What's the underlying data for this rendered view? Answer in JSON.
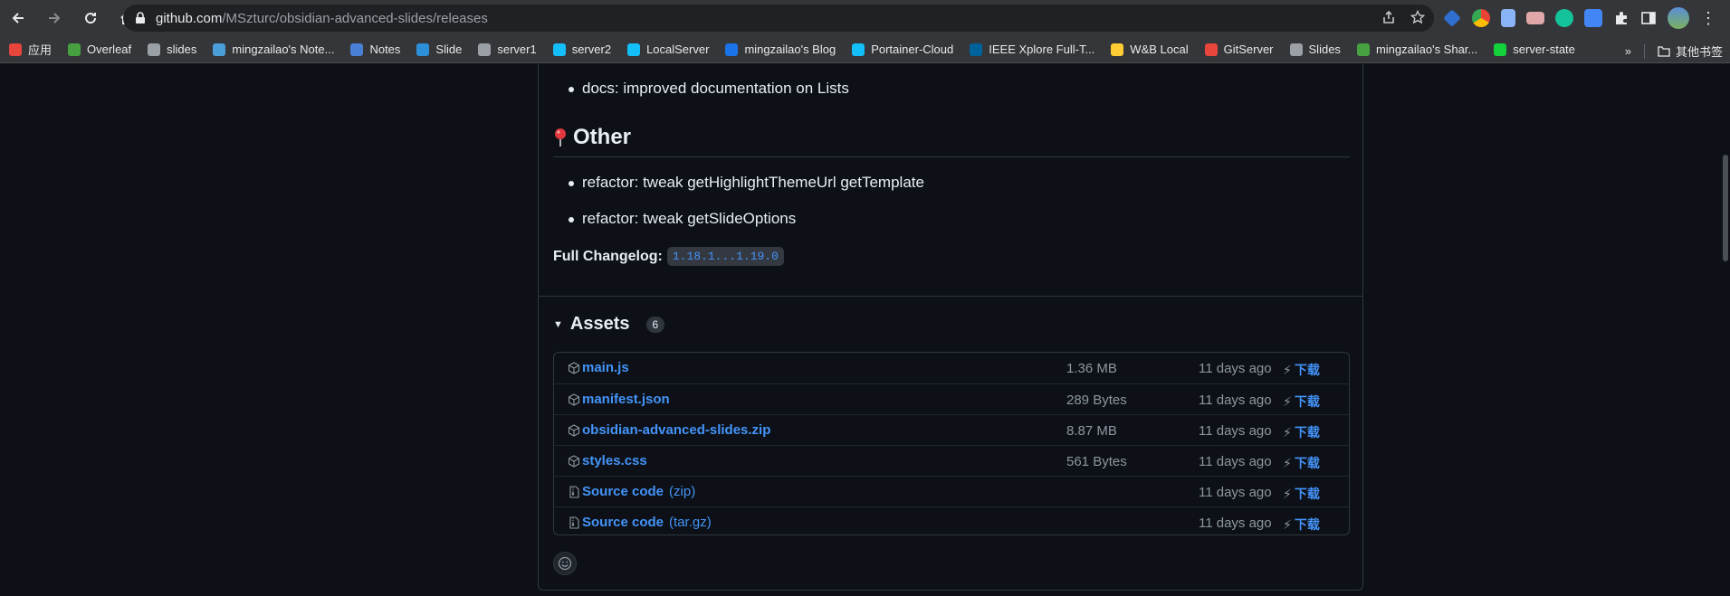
{
  "browser": {
    "url_host": "github.com",
    "url_path": "/MSzturc/obsidian-advanced-slides/releases"
  },
  "bookmarks": [
    {
      "label": "应用",
      "color": "#e8453c"
    },
    {
      "label": "Overleaf",
      "color": "#47a141"
    },
    {
      "label": "slides",
      "color": "#9aa0a6"
    },
    {
      "label": "mingzailao's Note...",
      "color": "#4a9fd8"
    },
    {
      "label": "Notes",
      "color": "#4a7fd8"
    },
    {
      "label": "Slide",
      "color": "#2d8fd8"
    },
    {
      "label": "server1",
      "color": "#9aa0a6"
    },
    {
      "label": "server2",
      "color": "#13bef9"
    },
    {
      "label": "LocalServer",
      "color": "#13bef9"
    },
    {
      "label": "mingzailao's Blog",
      "color": "#1a73e8"
    },
    {
      "label": "Portainer-Cloud",
      "color": "#13bef9"
    },
    {
      "label": "IEEE Xplore Full-T...",
      "color": "#00629b"
    },
    {
      "label": "W&B Local",
      "color": "#ffcc33"
    },
    {
      "label": "GitServer",
      "color": "#e8453c"
    },
    {
      "label": "Slides",
      "color": "#9aa0a6"
    },
    {
      "label": "mingzailao's Shar...",
      "color": "#47a141"
    },
    {
      "label": "server-state",
      "color": "#13d13a"
    }
  ],
  "bookmarks_overflow": "»",
  "other_bookmarks": "其他书签",
  "page": {
    "docs_item": "docs: improved documentation on Lists",
    "other_heading": "Other",
    "other_items": [
      "refactor: tweak getHighlightThemeUrl getTemplate",
      "refactor: tweak getSlideOptions"
    ],
    "changelog_label": "Full Changelog:",
    "changelog_link": "1.18.1...1.19.0",
    "assets_title": "Assets",
    "assets_count": "6",
    "assets": [
      {
        "name": "main.js",
        "suffix": "",
        "size": "1.36 MB",
        "date": "11 days ago",
        "download": "下载",
        "icon": "package-icon"
      },
      {
        "name": "manifest.json",
        "suffix": "",
        "size": "289 Bytes",
        "date": "11 days ago",
        "download": "下载",
        "icon": "package-icon"
      },
      {
        "name": "obsidian-advanced-slides.zip",
        "suffix": "",
        "size": "8.87 MB",
        "date": "11 days ago",
        "download": "下载",
        "icon": "package-icon"
      },
      {
        "name": "styles.css",
        "suffix": "",
        "size": "561 Bytes",
        "date": "11 days ago",
        "download": "下载",
        "icon": "package-icon"
      },
      {
        "name": "Source code",
        "suffix": "(zip)",
        "size": "",
        "date": "11 days ago",
        "download": "下载",
        "icon": "file-zip-icon"
      },
      {
        "name": "Source code",
        "suffix": "(tar.gz)",
        "size": "",
        "date": "11 days ago",
        "download": "下载",
        "icon": "file-zip-icon"
      }
    ]
  }
}
